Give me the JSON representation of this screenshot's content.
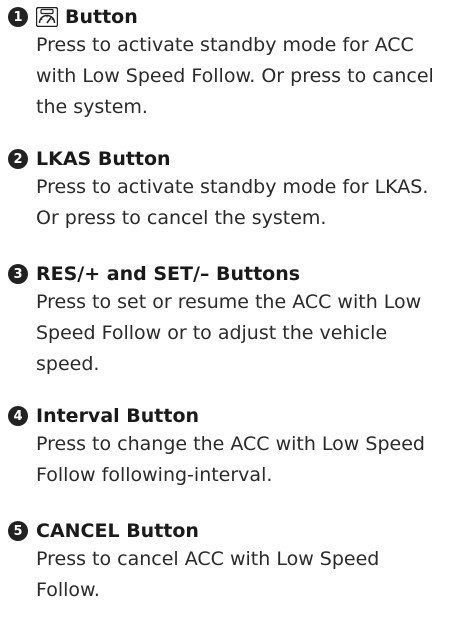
{
  "items": [
    {
      "number": "1",
      "icon": "acc-speedometer-icon",
      "heading": "Button",
      "lines": [
        "Press to activate standby mode for ACC",
        "with Low Speed Follow. Or press to cancel",
        "the system."
      ]
    },
    {
      "number": "2",
      "heading": "LKAS Button",
      "lines": [
        "Press to activate standby mode for LKAS.",
        "Or press to cancel the system."
      ]
    },
    {
      "number": "3",
      "heading": "RES/+ and SET/– Buttons",
      "lines": [
        "Press to set or resume the ACC with Low",
        "Speed Follow or to adjust the vehicle",
        "speed."
      ]
    },
    {
      "number": "4",
      "heading": "Interval Button",
      "lines": [
        "Press to change the ACC with Low Speed",
        "Follow following-interval."
      ]
    },
    {
      "number": "5",
      "heading": "CANCEL Button",
      "lines": [
        "Press to cancel ACC with Low Speed",
        "Follow."
      ]
    }
  ]
}
